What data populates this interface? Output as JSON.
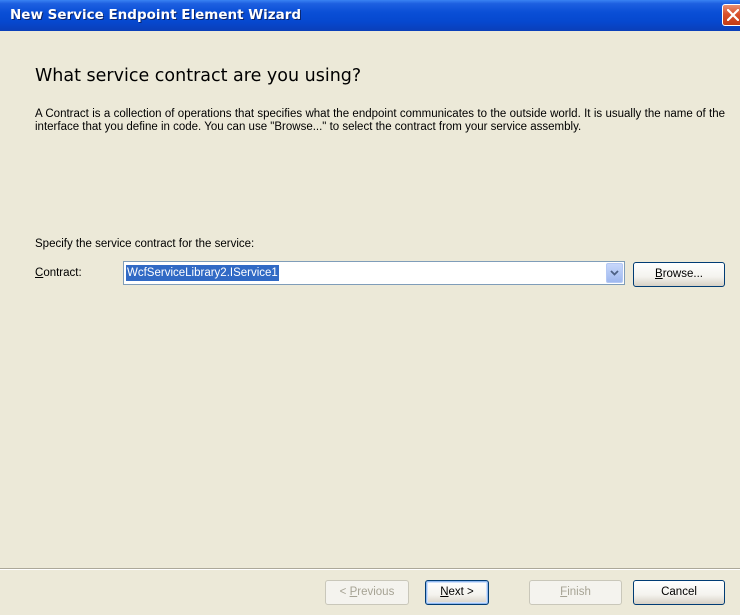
{
  "window": {
    "title": "New Service Endpoint Element Wizard",
    "close_icon": "close-icon"
  },
  "page": {
    "heading": "What service contract are you using?",
    "description": "A Contract is a collection of operations that specifies what the endpoint communicates to the outside world. It is usually the name of the interface that you define in code. You can use \"Browse...\" to select the contract from your service assembly.",
    "specify_label": "Specify the service contract for the service:"
  },
  "contract": {
    "label_accel": "C",
    "label_rest": "ontract:",
    "value": "WcfServiceLibrary2.IService1",
    "browse_accel": "B",
    "browse_rest": "rowse..."
  },
  "buttons": {
    "previous_prefix": "< ",
    "previous_accel": "P",
    "previous_rest": "revious",
    "next_accel": "N",
    "next_rest": "ext >",
    "finish_accel": "F",
    "finish_rest": "inish",
    "cancel": "Cancel"
  },
  "colors": {
    "titlebar": "#0a4fd6",
    "dialog_bg": "#ece9d8",
    "selection": "#316ac5",
    "close_button": "#d9512c"
  }
}
